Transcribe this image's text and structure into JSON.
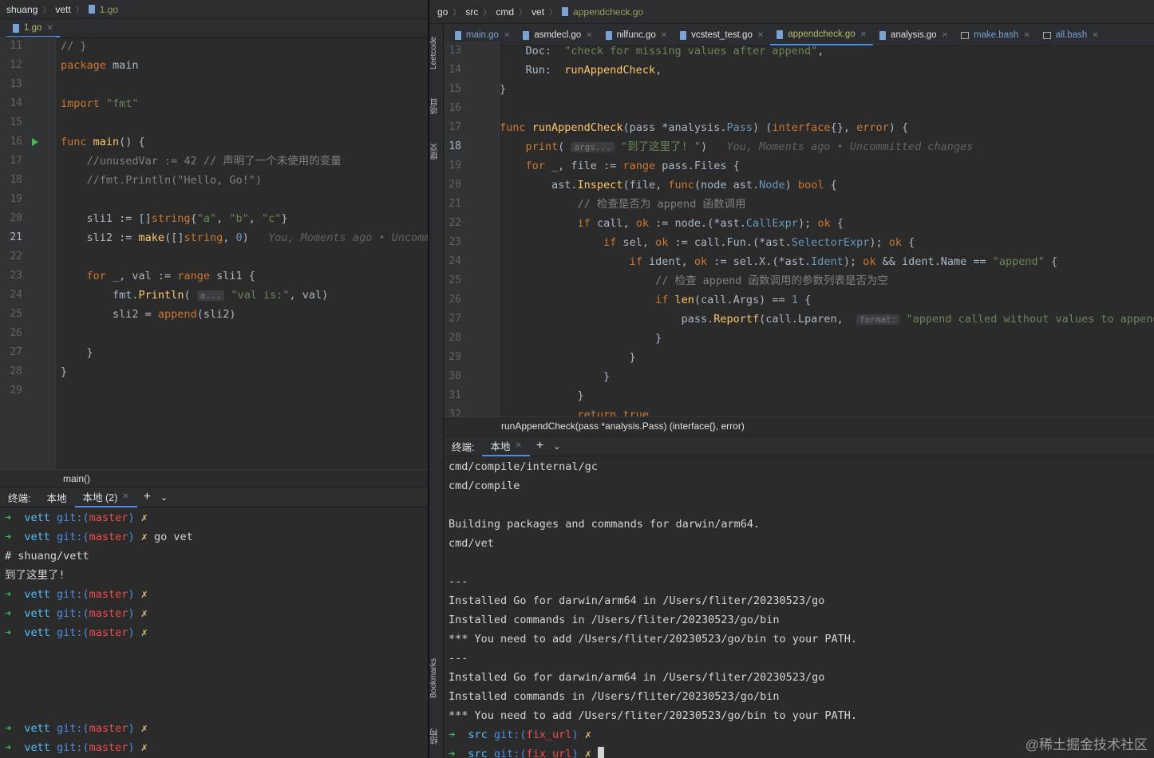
{
  "left": {
    "breadcrumbs": [
      "shuang",
      "vett",
      "1.go"
    ],
    "tab": "1.go",
    "code_lines": [
      {
        "n": "11",
        "html": "<span class='cm'>// }</span>"
      },
      {
        "n": "12",
        "html": "<span class='kw'>package</span> main"
      },
      {
        "n": "13",
        "html": ""
      },
      {
        "n": "14",
        "html": "<span class='kw'>import</span> <span class='str'>\"fmt\"</span>"
      },
      {
        "n": "15",
        "html": ""
      },
      {
        "n": "16",
        "html": "<span class='kw'>func</span> <span class='fn'>main</span>() {"
      },
      {
        "n": "17",
        "html": "    <span class='cm'>//unusedVar := 42 // 声明了一个未使用的变量</span>"
      },
      {
        "n": "18",
        "html": "    <span class='cm'>//fmt.Println(\"Hello, Go!\")</span>"
      },
      {
        "n": "19",
        "html": ""
      },
      {
        "n": "20",
        "html": "    sli1 := []<span class='kw'>string</span>{<span class='str'>\"a\"</span>, <span class='str'>\"b\"</span>, <span class='str'>\"c\"</span>}"
      },
      {
        "n": "21",
        "html": "    sli2 := <span class='fn'>make</span>([]<span class='kw'>string</span>, <span class='lit'>0</span>)   <span class='blame'>You, Moments ago • Uncommitted changes</span>"
      },
      {
        "n": "22",
        "html": ""
      },
      {
        "n": "23",
        "html": "    <span class='kw'>for</span> _, val := <span class='kw'>range</span> sli1 {"
      },
      {
        "n": "24",
        "html": "        fmt.<span class='fn'>Println</span>( <span class='hint'>a...</span> <span class='str'>\"val is:\"</span>, val)"
      },
      {
        "n": "25",
        "html": "        sli2 = <span class='kw'>append</span>(sli2)"
      },
      {
        "n": "26",
        "html": ""
      },
      {
        "n": "27",
        "html": "    }"
      },
      {
        "n": "28",
        "html": "}"
      },
      {
        "n": "29",
        "html": ""
      }
    ],
    "current_line": "21",
    "structure_crumb": "main()",
    "terminal_tabs": {
      "label": "终端:",
      "tab1": "本地",
      "tab2": "本地 (2)"
    },
    "terminal_lines": [
      {
        "t": "prompt",
        "dir": "vett",
        "branch": "master",
        "cmd": ""
      },
      {
        "t": "prompt",
        "dir": "vett",
        "branch": "master",
        "cmd": "go vet"
      },
      {
        "t": "out",
        "text": "# shuang/vett"
      },
      {
        "t": "out",
        "text": "到了这里了!"
      },
      {
        "t": "prompt",
        "dir": "vett",
        "branch": "master",
        "cmd": ""
      },
      {
        "t": "prompt",
        "dir": "vett",
        "branch": "master",
        "cmd": ""
      },
      {
        "t": "prompt",
        "dir": "vett",
        "branch": "master",
        "cmd": ""
      },
      {
        "t": "blank"
      },
      {
        "t": "blank"
      },
      {
        "t": "blank"
      },
      {
        "t": "blank"
      },
      {
        "t": "prompt",
        "dir": "vett",
        "branch": "master",
        "cmd": ""
      },
      {
        "t": "prompt",
        "dir": "vett",
        "branch": "master",
        "cmd": ""
      }
    ]
  },
  "right": {
    "breadcrumbs": [
      "go",
      "src",
      "cmd",
      "vet",
      "appendcheck.go"
    ],
    "tabs": [
      {
        "label": "main.go",
        "kind": "go",
        "state": "blue"
      },
      {
        "label": "asmdecl.go",
        "kind": "go",
        "state": ""
      },
      {
        "label": "nilfunc.go",
        "kind": "go",
        "state": ""
      },
      {
        "label": "vcstest_test.go",
        "kind": "go",
        "state": ""
      },
      {
        "label": "appendcheck.go",
        "kind": "go",
        "state": "active"
      },
      {
        "label": "analysis.go",
        "kind": "go",
        "state": ""
      },
      {
        "label": "make.bash",
        "kind": "sh",
        "state": "blue"
      },
      {
        "label": "all.bash",
        "kind": "sh",
        "state": "blue"
      }
    ],
    "code_lines": [
      {
        "n": "13",
        "html": "    Doc:  <span class='str'>\"check for missing values after append\"</span>,"
      },
      {
        "n": "14",
        "html": "    Run:  <span class='fn'>runAppendCheck</span>,"
      },
      {
        "n": "15",
        "html": "}"
      },
      {
        "n": "16",
        "html": ""
      },
      {
        "n": "17",
        "html": "<span class='kw'>func</span> <span class='fn'>runAppendCheck</span>(pass *analysis.<span class='lit'>Pass</span>) (<span class='kw'>interface</span>{}, <span class='kw'>error</span>) {"
      },
      {
        "n": "18",
        "html": "    <span class='kw'>print</span>( <span class='hint'>args...</span> <span class='str'>\"到了这里了! \"</span>)   <span class='blame'>You, Moments ago • Uncommitted changes</span>"
      },
      {
        "n": "19",
        "html": "    <span class='kw'>for</span> _, file := <span class='kw'>range</span> pass.Files {"
      },
      {
        "n": "20",
        "html": "        ast.<span class='fn'>Inspect</span>(file, <span class='kw'>func</span>(node ast.<span class='lit'>Node</span>) <span class='kw'>bool</span> {"
      },
      {
        "n": "21",
        "html": "            <span class='cm'>// 检查是否为 append 函数调用</span>"
      },
      {
        "n": "22",
        "html": "            <span class='kw'>if</span> call, <span class='kw'>ok</span> := node.(*ast.<span class='lit'>CallExpr</span>); <span class='kw'>ok</span> {"
      },
      {
        "n": "23",
        "html": "                <span class='kw'>if</span> sel, <span class='kw'>ok</span> := call.Fun.(*ast.<span class='lit'>SelectorExpr</span>); <span class='kw'>ok</span> {"
      },
      {
        "n": "24",
        "html": "                    <span class='kw'>if</span> ident, <span class='kw'>ok</span> := sel.X.(*ast.<span class='lit'>Ident</span>); <span class='kw'>ok</span> &amp;&amp; ident.Name == <span class='str'>\"append\"</span> {"
      },
      {
        "n": "25",
        "html": "                        <span class='cm'>// 检查 append 函数调用的参数列表是否为空</span>"
      },
      {
        "n": "26",
        "html": "                        <span class='kw'>if</span> <span class='fn'>len</span>(call.Args) == <span class='lit'>1</span> {"
      },
      {
        "n": "27",
        "html": "                            pass.<span class='fn'>Reportf</span>(call.Lparen,  <span class='hint'>format:</span> <span class='str'>\"append called without values to append\"</span>)"
      },
      {
        "n": "28",
        "html": "                        }"
      },
      {
        "n": "29",
        "html": "                    }"
      },
      {
        "n": "30",
        "html": "                }"
      },
      {
        "n": "31",
        "html": "            }"
      },
      {
        "n": "32",
        "html": "            <span class='kw'>return true</span>"
      }
    ],
    "current_line": "18",
    "structure_crumb": "runAppendCheck(pass *analysis.Pass) (interface{}, error)",
    "terminal_tabs": {
      "label": "终端:",
      "tab1": "本地"
    },
    "terminal_lines": [
      {
        "t": "out",
        "text": "cmd/compile/internal/gc"
      },
      {
        "t": "out",
        "text": "cmd/compile"
      },
      {
        "t": "blank"
      },
      {
        "t": "out",
        "text": "Building packages and commands for darwin/arm64."
      },
      {
        "t": "out",
        "text": "cmd/vet"
      },
      {
        "t": "blank"
      },
      {
        "t": "out",
        "text": "---"
      },
      {
        "t": "out",
        "text": "Installed Go for darwin/arm64 in /Users/fliter/20230523/go"
      },
      {
        "t": "out",
        "text": "Installed commands in /Users/fliter/20230523/go/bin"
      },
      {
        "t": "out",
        "text": "*** You need to add /Users/fliter/20230523/go/bin to your PATH."
      },
      {
        "t": "out",
        "text": "---"
      },
      {
        "t": "out",
        "text": "Installed Go for darwin/arm64 in /Users/fliter/20230523/go"
      },
      {
        "t": "out",
        "text": "Installed commands in /Users/fliter/20230523/go/bin"
      },
      {
        "t": "out",
        "text": "*** You need to add /Users/fliter/20230523/go/bin to your PATH."
      },
      {
        "t": "prompt",
        "dir": "src",
        "branch": "fix_url",
        "cmd": ""
      },
      {
        "t": "prompt",
        "dir": "src",
        "branch": "fix_url",
        "cmd": "",
        "cursor": true
      }
    ]
  },
  "side_strip": [
    "Leetcode",
    "项目",
    "提交",
    "Bookmarks",
    "结构"
  ],
  "watermark": "@稀土掘金技术社区",
  "colors": {
    "accent": "#4e8de6",
    "background": "#2b2b2b",
    "prompt_arrow": "#3fb950",
    "branch": "#f14c4c"
  }
}
